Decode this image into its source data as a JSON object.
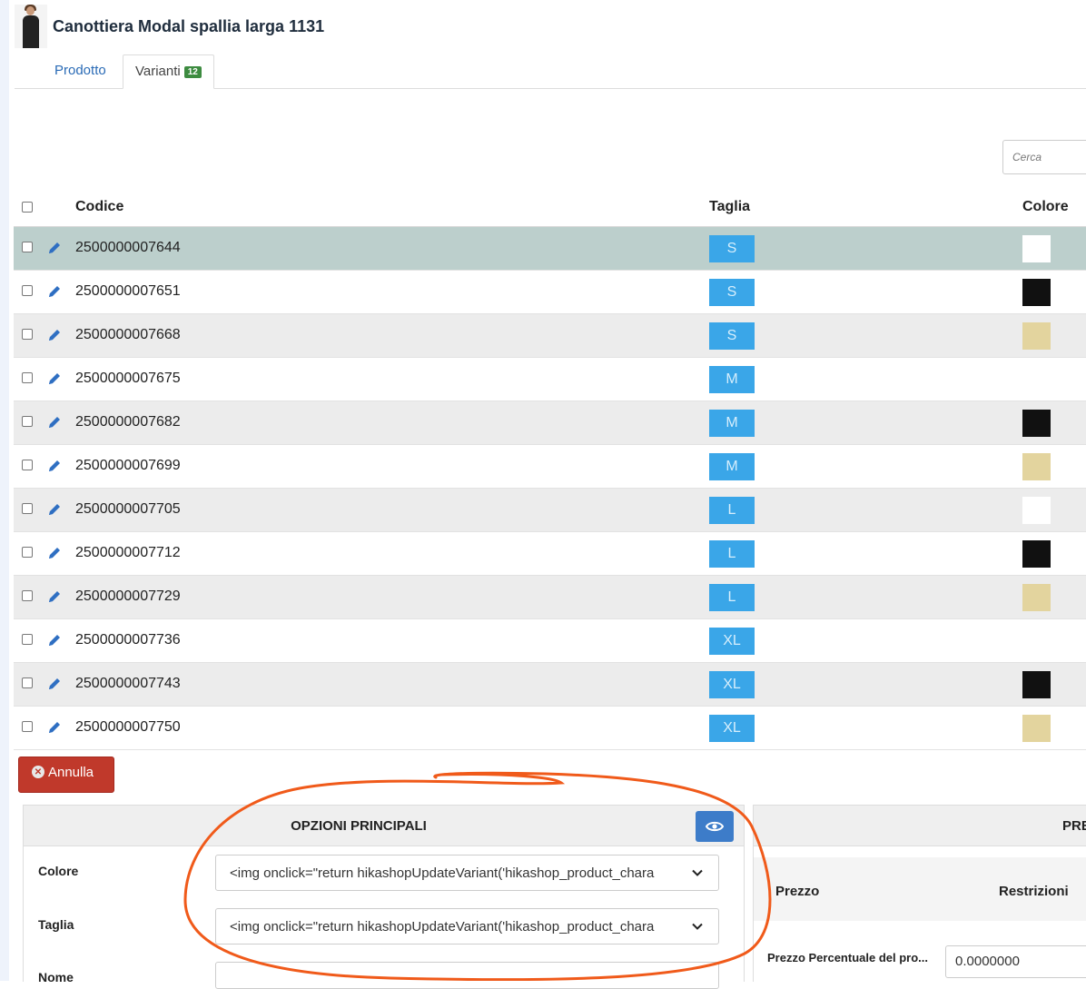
{
  "product": {
    "title": "Canottiera Modal spallia larga 1131"
  },
  "tabs": [
    {
      "label": "Prodotto"
    },
    {
      "label": "Varianti",
      "badge": "12"
    }
  ],
  "search": {
    "placeholder": "Cerca"
  },
  "table": {
    "headers": {
      "code": "Codice",
      "size": "Taglia",
      "color": "Colore"
    },
    "rows": [
      {
        "code": "2500000007644",
        "size": "S",
        "color": "#ffffff",
        "selected": true
      },
      {
        "code": "2500000007651",
        "size": "S",
        "color": "#111111"
      },
      {
        "code": "2500000007668",
        "size": "S",
        "color": "#e3d49e"
      },
      {
        "code": "2500000007675",
        "size": "M",
        "color": ""
      },
      {
        "code": "2500000007682",
        "size": "M",
        "color": "#111111"
      },
      {
        "code": "2500000007699",
        "size": "M",
        "color": "#e3d49e"
      },
      {
        "code": "2500000007705",
        "size": "L",
        "color": "#ffffff"
      },
      {
        "code": "2500000007712",
        "size": "L",
        "color": "#111111"
      },
      {
        "code": "2500000007729",
        "size": "L",
        "color": "#e3d49e"
      },
      {
        "code": "2500000007736",
        "size": "XL",
        "color": ""
      },
      {
        "code": "2500000007743",
        "size": "XL",
        "color": "#111111"
      },
      {
        "code": "2500000007750",
        "size": "XL",
        "color": "#e3d49e"
      }
    ]
  },
  "actions": {
    "cancel_label": "Annulla"
  },
  "main_options": {
    "title": "OPZIONI PRINCIPALI",
    "fields": {
      "colore": {
        "label": "Colore",
        "value": "<img onclick=\"return hikashopUpdateVariant('hikashop_product_chara"
      },
      "taglia": {
        "label": "Taglia",
        "value": "<img onclick=\"return hikashopUpdateVariant('hikashop_product_chara"
      },
      "nome": {
        "label": "Nome"
      }
    }
  },
  "price_panel": {
    "title": "PRE",
    "columns": {
      "price": "Prezzo",
      "restrictions": "Restrizioni"
    },
    "percent_label": "Prezzo Percentuale del pro...",
    "percent_value": "0.0000000"
  },
  "colors": {
    "accent_blue": "#3d7cc9",
    "size_badge": "#3aa6e8",
    "cancel_red": "#c0392b",
    "badge_green": "#3d8b40",
    "selected_row": "#bccfcc",
    "annotation_orange": "#f05a1a"
  }
}
